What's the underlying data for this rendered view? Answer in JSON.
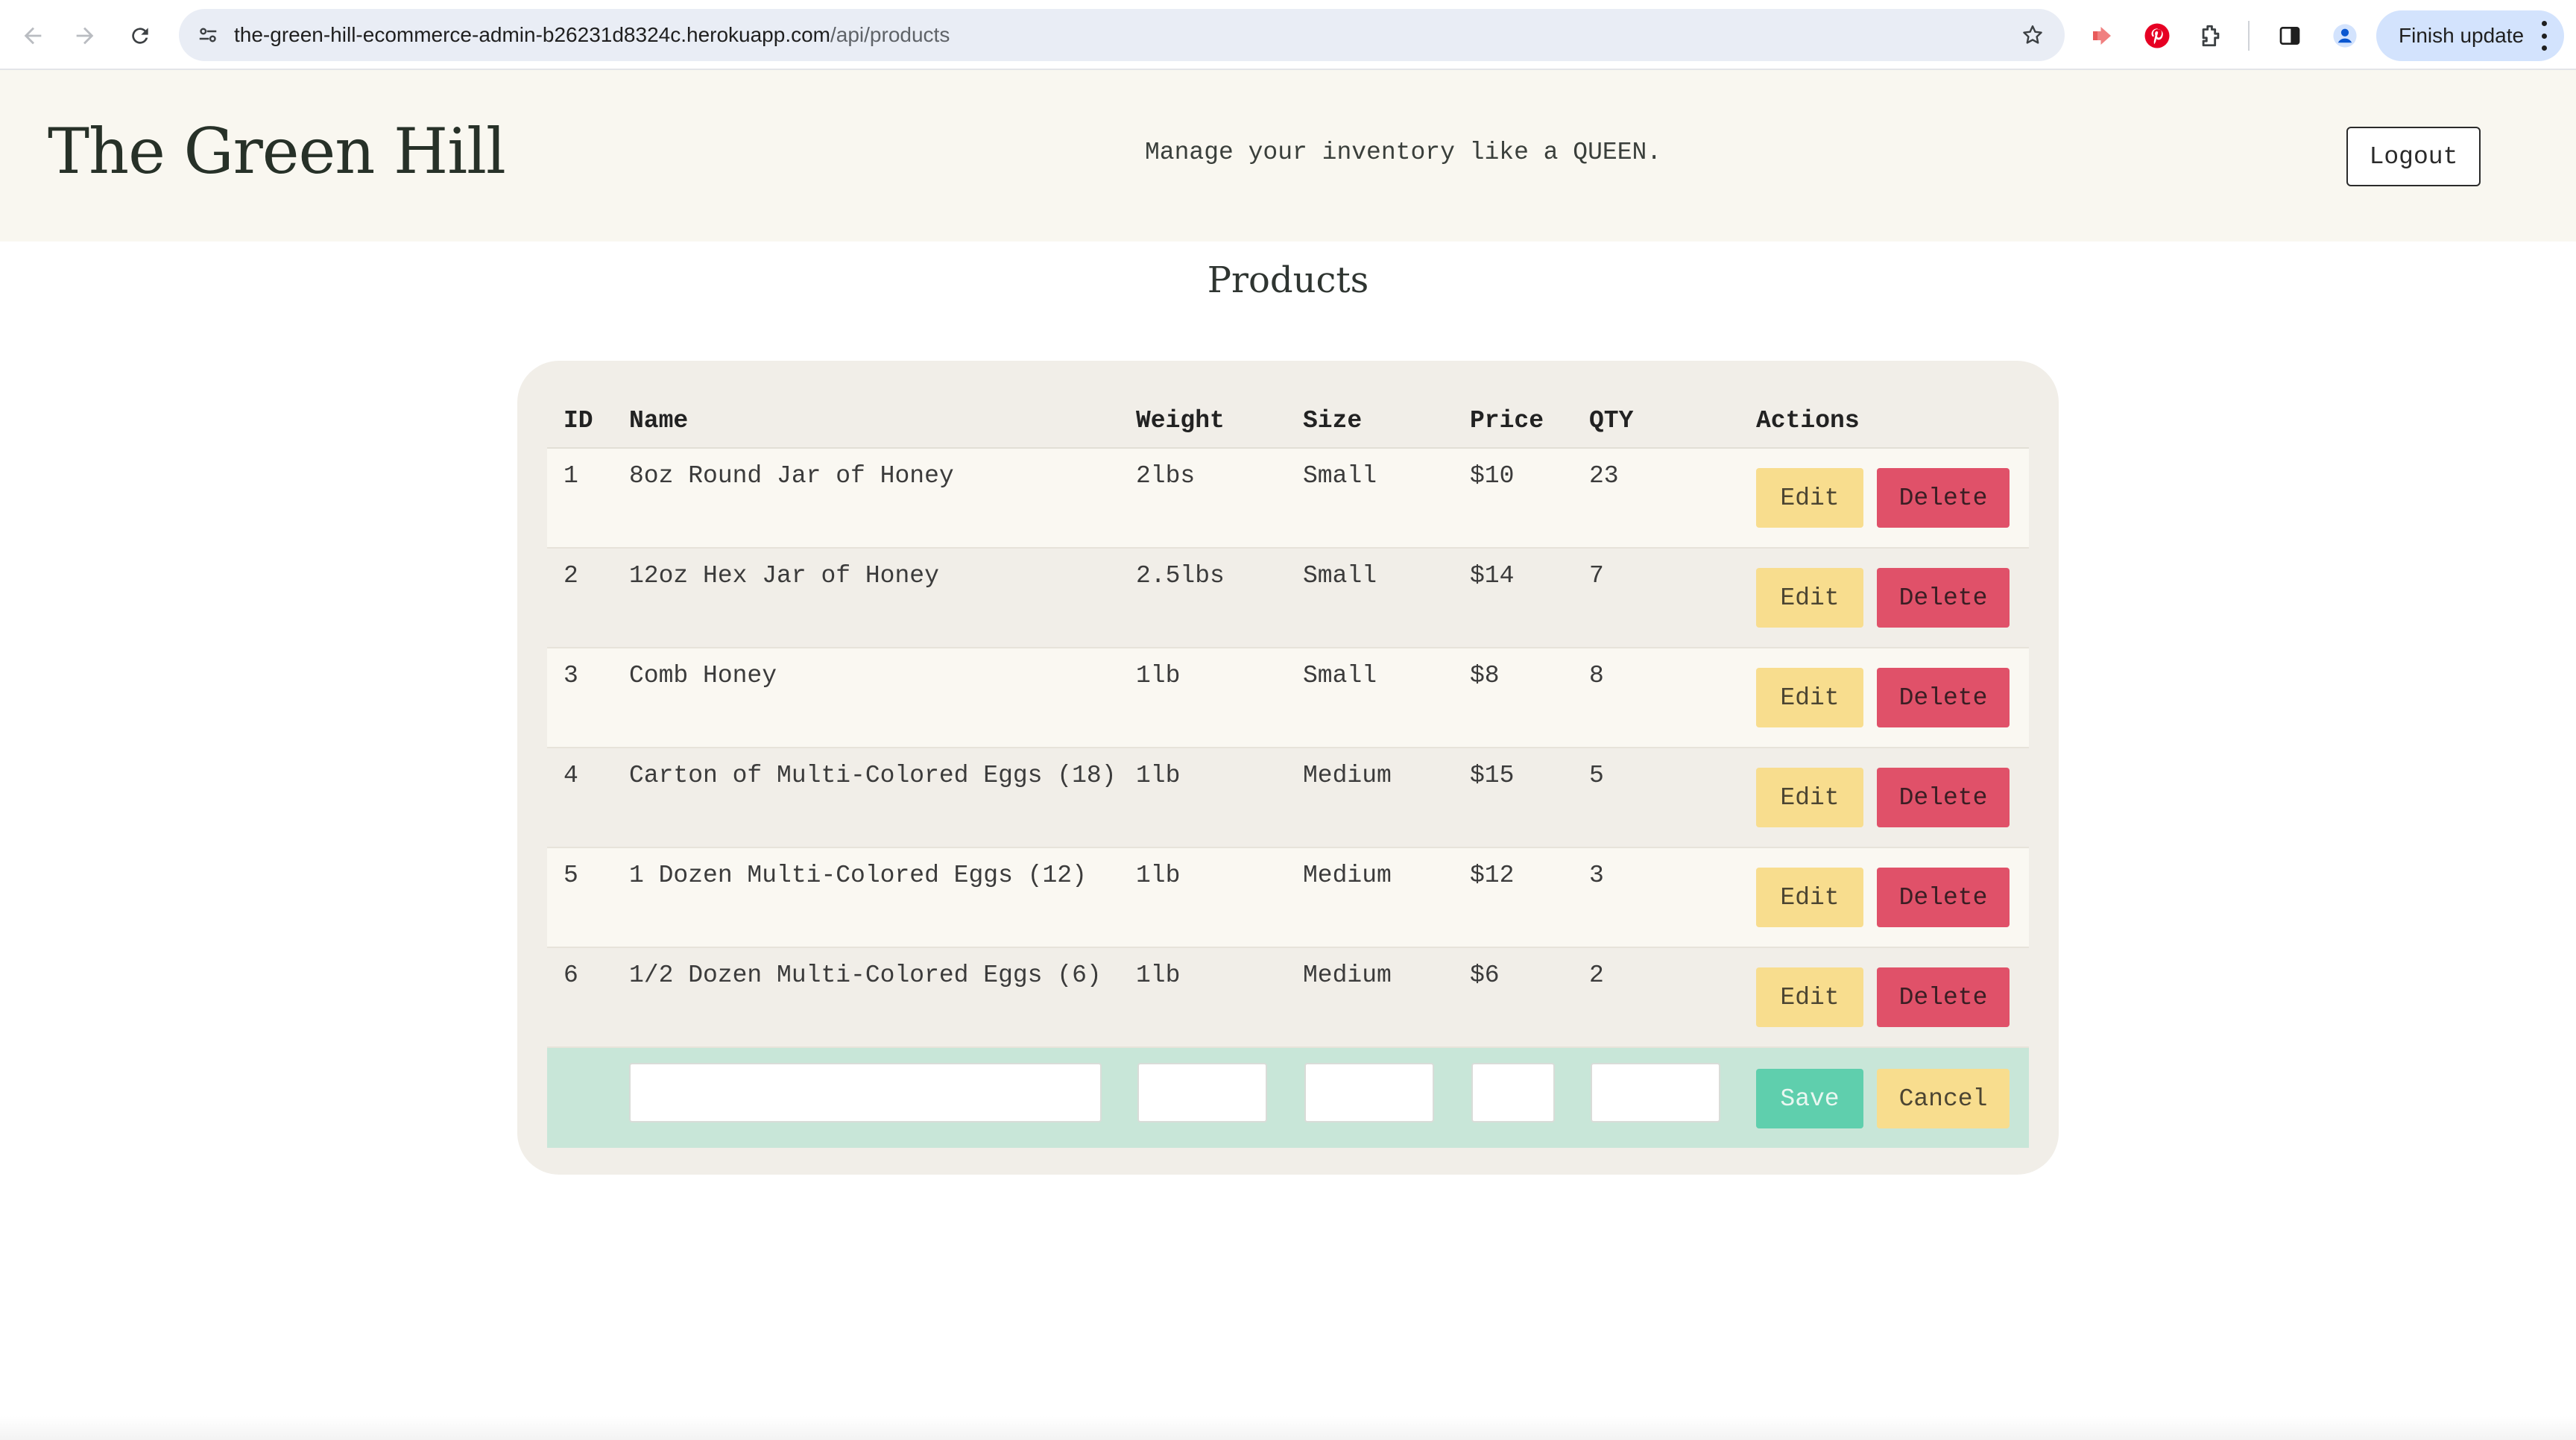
{
  "browser": {
    "url_host": "the-green-hill-ecommerce-admin-b26231d8324c.herokuapp.com",
    "url_path": "/api/products",
    "finish_update_label": "Finish update"
  },
  "header": {
    "brand": "The Green Hill",
    "tagline": "Manage your inventory like a QUEEN.",
    "logout_label": "Logout"
  },
  "page": {
    "title": "Products"
  },
  "table": {
    "columns": {
      "id": "ID",
      "name": "Name",
      "weight": "Weight",
      "size": "Size",
      "price": "Price",
      "qty": "QTY",
      "actions": "Actions"
    },
    "rows": [
      {
        "id": "1",
        "name": "8oz Round Jar of Honey",
        "weight": "2lbs",
        "size": "Small",
        "price": "$10",
        "qty": "23"
      },
      {
        "id": "2",
        "name": "12oz Hex Jar of Honey",
        "weight": "2.5lbs",
        "size": "Small",
        "price": "$14",
        "qty": "7"
      },
      {
        "id": "3",
        "name": "Comb Honey",
        "weight": "1lb",
        "size": "Small",
        "price": "$8",
        "qty": "8"
      },
      {
        "id": "4",
        "name": "Carton of Multi-Colored Eggs (18)",
        "weight": "1lb",
        "size": "Medium",
        "price": "$15",
        "qty": "5"
      },
      {
        "id": "5",
        "name": "1 Dozen Multi-Colored Eggs (12)",
        "weight": "1lb",
        "size": "Medium",
        "price": "$12",
        "qty": "3"
      },
      {
        "id": "6",
        "name": "1/2 Dozen Multi-Colored Eggs (6)",
        "weight": "1lb",
        "size": "Medium",
        "price": "$6",
        "qty": "2"
      }
    ],
    "edit_label": "Edit",
    "delete_label": "Delete",
    "new_row": {
      "name_value": "",
      "weight_value": "",
      "size_value": "",
      "price_value": "",
      "qty_value": "",
      "save_label": "Save",
      "cancel_label": "Cancel"
    }
  },
  "colors": {
    "header_bg": "#f9f7f0",
    "card_bg": "#f1eee8",
    "edit_button": "#f8dd8e",
    "delete_button": "#e05169",
    "save_button": "#5fcfad",
    "new_row_bg": "#c8e6d8"
  }
}
